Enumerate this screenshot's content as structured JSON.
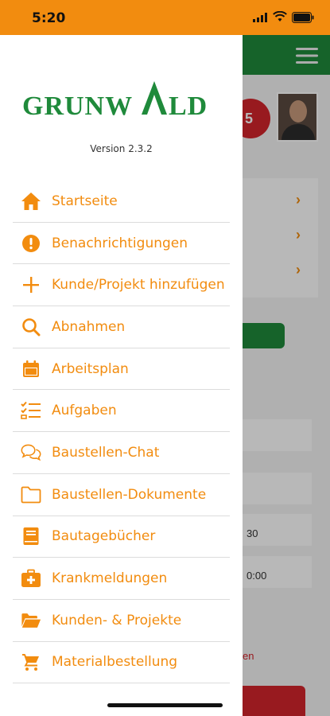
{
  "status_bar": {
    "time": "5:20"
  },
  "background": {
    "badge_count": "5",
    "row_texts": [
      "30",
      "0:00"
    ],
    "red_text": "en"
  },
  "drawer": {
    "logo_text": "GRUNWALD",
    "version": "Version 2.3.2",
    "items": [
      {
        "label": "Startseite",
        "icon": "home-icon"
      },
      {
        "label": "Benachrichtigungen",
        "icon": "alert-circle-icon"
      },
      {
        "label": "Kunde/Projekt hinzufügen",
        "icon": "plus-icon"
      },
      {
        "label": "Abnahmen",
        "icon": "search-icon"
      },
      {
        "label": "Arbeitsplan",
        "icon": "calendar-icon"
      },
      {
        "label": "Aufgaben",
        "icon": "checklist-icon"
      },
      {
        "label": "Baustellen-Chat",
        "icon": "chat-icon"
      },
      {
        "label": "Baustellen-Dokumente",
        "icon": "folder-icon"
      },
      {
        "label": "Bautagebücher",
        "icon": "book-icon"
      },
      {
        "label": "Krankmeldungen",
        "icon": "medical-kit-icon"
      },
      {
        "label": "Kunden- & Projekte",
        "icon": "folder-open-icon"
      },
      {
        "label": "Materialbestellung",
        "icon": "cart-icon"
      }
    ]
  },
  "colors": {
    "accent": "#f28c0f",
    "brand_green": "#1f8a3b",
    "alert_red": "#d3242c"
  }
}
